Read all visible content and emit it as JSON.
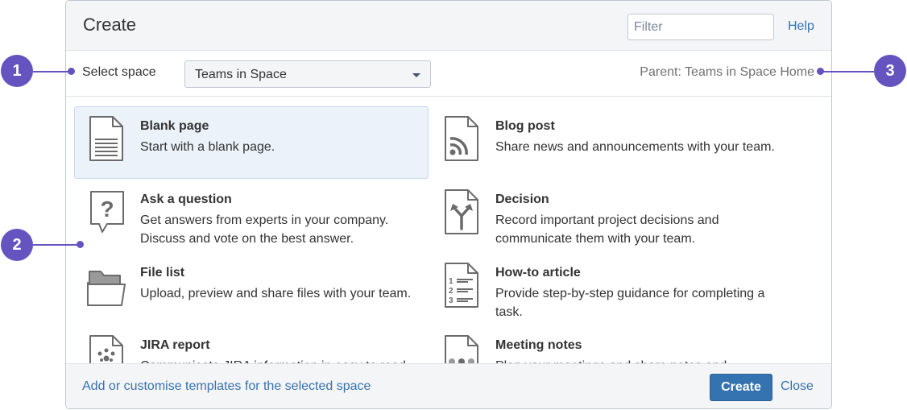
{
  "dialog": {
    "title": "Create",
    "filter_placeholder": "Filter",
    "help_label": "Help",
    "space_label": "Select space",
    "space_value": "Teams in Space",
    "parent_label": "Parent: Teams in Space Home",
    "footer_link": "Add or customise templates for the selected space",
    "create_label": "Create",
    "close_label": "Close"
  },
  "templates": [
    {
      "name": "Blank page",
      "description": "Start with a blank page.",
      "icon": "blank-page-icon",
      "selected": true
    },
    {
      "name": "Blog post",
      "description": "Share news and announcements with your team.",
      "icon": "blog-post-icon"
    },
    {
      "name": "Ask a question",
      "description": "Get answers from experts in your company. Discuss and vote on the best answer.",
      "icon": "question-icon"
    },
    {
      "name": "Decision",
      "description": "Record important project decisions and communicate them with your team.",
      "icon": "decision-icon"
    },
    {
      "name": "File list",
      "description": "Upload, preview and share files with your team.",
      "icon": "folder-icon"
    },
    {
      "name": "How-to article",
      "description": "Provide step-by-step guidance for completing a task.",
      "icon": "numbered-list-icon"
    },
    {
      "name": "JIRA report",
      "description": "Communicate JIRA information in easy to read",
      "icon": "jira-report-icon"
    },
    {
      "name": "Meeting notes",
      "description": "Plan your meetings and share notes and",
      "icon": "meeting-notes-icon"
    }
  ],
  "callouts": [
    "1",
    "2",
    "3"
  ],
  "colors": {
    "accent": "#3572b0",
    "callout": "#6554c0",
    "selected_bg": "#ebf2fa"
  }
}
